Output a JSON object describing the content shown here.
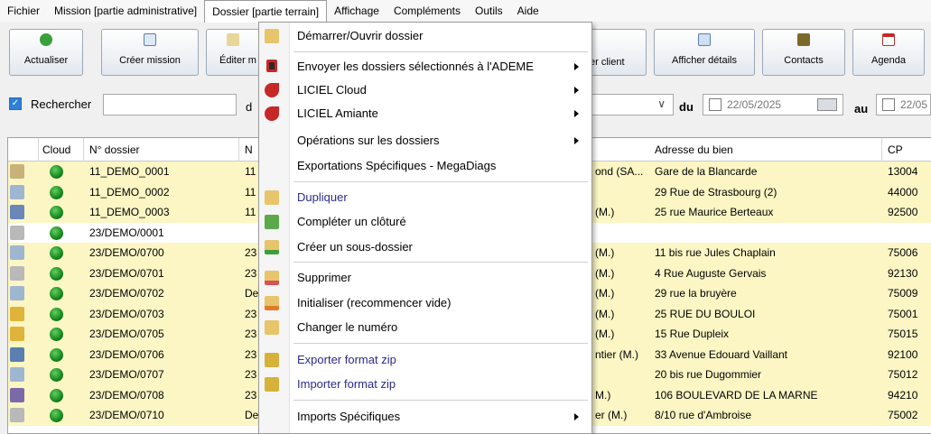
{
  "menubar": [
    "Fichier",
    "Mission [partie administrative]",
    "Dossier [partie terrain]",
    "Affichage",
    "Compléments",
    "Outils",
    "Aide"
  ],
  "toolbar": {
    "actualiser": "Actualiser",
    "creer_mission": "Créer mission",
    "editer": "Éditer m",
    "client": "er client",
    "afficher_details": "Afficher détails",
    "contacts": "Contacts",
    "agenda": "Agenda"
  },
  "search": {
    "label": "Rechercher",
    "value": "",
    "label_d": "d",
    "du": "du",
    "date_from": "22/05/2025",
    "au": "au",
    "date_to": "22/05"
  },
  "table": {
    "headers": [
      "Cloud",
      "N° dossier",
      "N",
      "Adresse du bien",
      "CP"
    ],
    "rows": [
      {
        "dossier": "11_DEMO_0001",
        "n": "11",
        "mid": "ond (SA...",
        "adresse": "Gare de la Blancarde",
        "cp": "13004"
      },
      {
        "dossier": "11_DEMO_0002",
        "n": "11",
        "mid": "",
        "adresse": "29 Rue de Strasbourg (2)",
        "cp": "44000"
      },
      {
        "dossier": "11_DEMO_0003",
        "n": "11",
        "mid": "(M.)",
        "adresse": "25 rue Maurice Berteaux",
        "cp": "92500"
      },
      {
        "dossier": "23/DEMO/0001",
        "n": "",
        "mid": "",
        "adresse": "",
        "cp": ""
      },
      {
        "dossier": "23/DEMO/0700",
        "n": "23",
        "mid": "(M.)",
        "adresse": "11 bis rue Jules Chaplain",
        "cp": "75006"
      },
      {
        "dossier": "23/DEMO/0701",
        "n": "23",
        "mid": "(M.)",
        "adresse": "4 Rue Auguste Gervais",
        "cp": "92130"
      },
      {
        "dossier": "23/DEMO/0702",
        "n": "De",
        "mid": "(M.)",
        "adresse": "29 rue la bruyère",
        "cp": "75009"
      },
      {
        "dossier": "23/DEMO/0703",
        "n": "23",
        "mid": "(M.)",
        "adresse": "25 RUE DU BOULOI",
        "cp": "75001"
      },
      {
        "dossier": "23/DEMO/0705",
        "n": "23",
        "mid": "(M.)",
        "adresse": "15 Rue Dupleix",
        "cp": "75015"
      },
      {
        "dossier": "23/DEMO/0706",
        "n": "23",
        "mid": "ntier (M.)",
        "adresse": "33 Avenue Edouard Vaillant",
        "cp": "92100"
      },
      {
        "dossier": "23/DEMO/0707",
        "n": "23",
        "mid": "",
        "adresse": "20 bis rue Dugommier",
        "cp": "75012"
      },
      {
        "dossier": "23/DEMO/0708",
        "n": "23",
        "mid": "M.)",
        "adresse": "106 BOULEVARD DE LA MARNE",
        "cp": "94210"
      },
      {
        "dossier": "23/DEMO/0710",
        "n": "De",
        "mid": "er (M.)",
        "adresse": "8/10 rue d'Ambroise",
        "cp": "75002"
      }
    ]
  },
  "menu": {
    "items": [
      {
        "label": "Démarrer/Ouvrir dossier"
      },
      {
        "label": "Envoyer les dossiers sélectionnés à l'ADEME"
      },
      {
        "label": "LICIEL Cloud"
      },
      {
        "label": "LICIEL Amiante"
      },
      {
        "label": "Opérations sur les dossiers"
      },
      {
        "label": "Exportations Spécifiques - MegaDiags"
      },
      {
        "label": "Dupliquer"
      },
      {
        "label": "Compléter un clôturé"
      },
      {
        "label": "Créer un sous-dossier"
      },
      {
        "label": "Supprimer"
      },
      {
        "label": "Initialiser (recommencer vide)"
      },
      {
        "label": "Changer le numéro"
      },
      {
        "label": "Exporter format zip"
      },
      {
        "label": "Importer format zip"
      },
      {
        "label": "Imports Spécifiques"
      }
    ]
  }
}
